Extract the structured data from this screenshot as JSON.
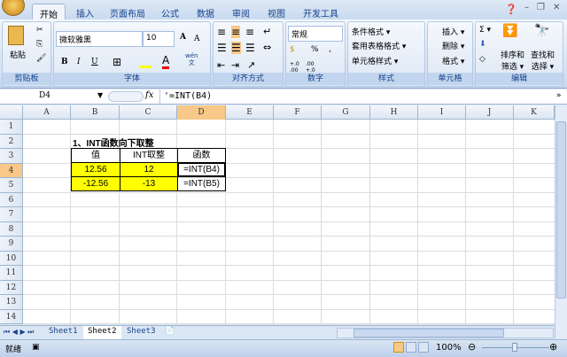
{
  "tabs": [
    "开始",
    "插入",
    "页面布局",
    "公式",
    "数据",
    "审阅",
    "视图",
    "开发工具"
  ],
  "ribbon": {
    "clipboard": {
      "paste": "粘贴",
      "label": "剪贴板"
    },
    "font": {
      "name": "微软雅黑",
      "size": "10",
      "label": "字体",
      "bold": "B",
      "italic": "I",
      "underline": "U",
      "grow": "A",
      "shrink": "A",
      "wen": "wén\n文"
    },
    "align": {
      "label": "对齐方式"
    },
    "number": {
      "format": "常规",
      "percent": "%",
      "comma": ",",
      "inc": "+.0 .00",
      "dec": ".00 +.0",
      "label": "数字"
    },
    "styles": {
      "cond": "条件格式 ▾",
      "table": "套用表格格式 ▾",
      "cell": "单元格样式 ▾",
      "label": "样式"
    },
    "cells": {
      "insert": "插入 ▾",
      "delete": "删除 ▾",
      "format": "格式 ▾",
      "label": "单元格"
    },
    "editing": {
      "sum": "Σ ▾",
      "sort": "排序和\n筛选 ▾",
      "find": "查找和\n选择 ▾",
      "label": "编辑"
    }
  },
  "formula_bar": {
    "name_box": "D4",
    "fx": "fx",
    "formula": "'=INT(B4)"
  },
  "columns": [
    "A",
    "B",
    "C",
    "D",
    "E",
    "F",
    "G",
    "H",
    "I",
    "J",
    "K"
  ],
  "rows": [
    "1",
    "2",
    "3",
    "4",
    "5",
    "6",
    "7",
    "8",
    "9",
    "10",
    "11",
    "12",
    "13",
    "14"
  ],
  "sheet": {
    "title": "1、INT函数向下取整",
    "headers": [
      "值",
      "INT取整",
      "函数"
    ],
    "data": [
      [
        "12.56",
        "12",
        "=INT(B4)"
      ],
      [
        "-12.56",
        "-13",
        "=INT(B5)"
      ]
    ]
  },
  "sheet_tabs": [
    "Sheet1",
    "Sheet2",
    "Sheet3"
  ],
  "status": {
    "ready": "就绪",
    "zoom": "100%"
  }
}
